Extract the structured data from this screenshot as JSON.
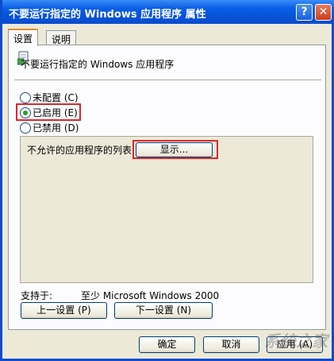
{
  "window": {
    "title": "不要运行指定的 Windows 应用程序 属性",
    "help_glyph": "?",
    "close_glyph": "✕"
  },
  "tabs": [
    {
      "label": "设置"
    },
    {
      "label": "说明"
    }
  ],
  "policy": {
    "title": "不要运行指定的 Windows 应用程序",
    "icon": "policy-document-icon"
  },
  "state": {
    "options": [
      {
        "label": "未配置 (C)",
        "checked": false
      },
      {
        "label": "已启用 (E)",
        "checked": true
      },
      {
        "label": "已禁用 (D)",
        "checked": false
      }
    ]
  },
  "options_panel": {
    "label": "不允许的应用程序的列表",
    "show_button": "显示..."
  },
  "supported": {
    "label": "支持于:",
    "value": "至少 Microsoft Windows 2000"
  },
  "nav": {
    "prev": "上一设置 (P)",
    "next": "下一设置 (N)"
  },
  "footer": {
    "ok": "确定",
    "cancel": "取消",
    "apply": "应用 (A)"
  },
  "watermark": "系统之家",
  "colors": {
    "accent": "#0a4ccf",
    "highlight": "#e0262b",
    "radio_checked": "#21a121"
  }
}
